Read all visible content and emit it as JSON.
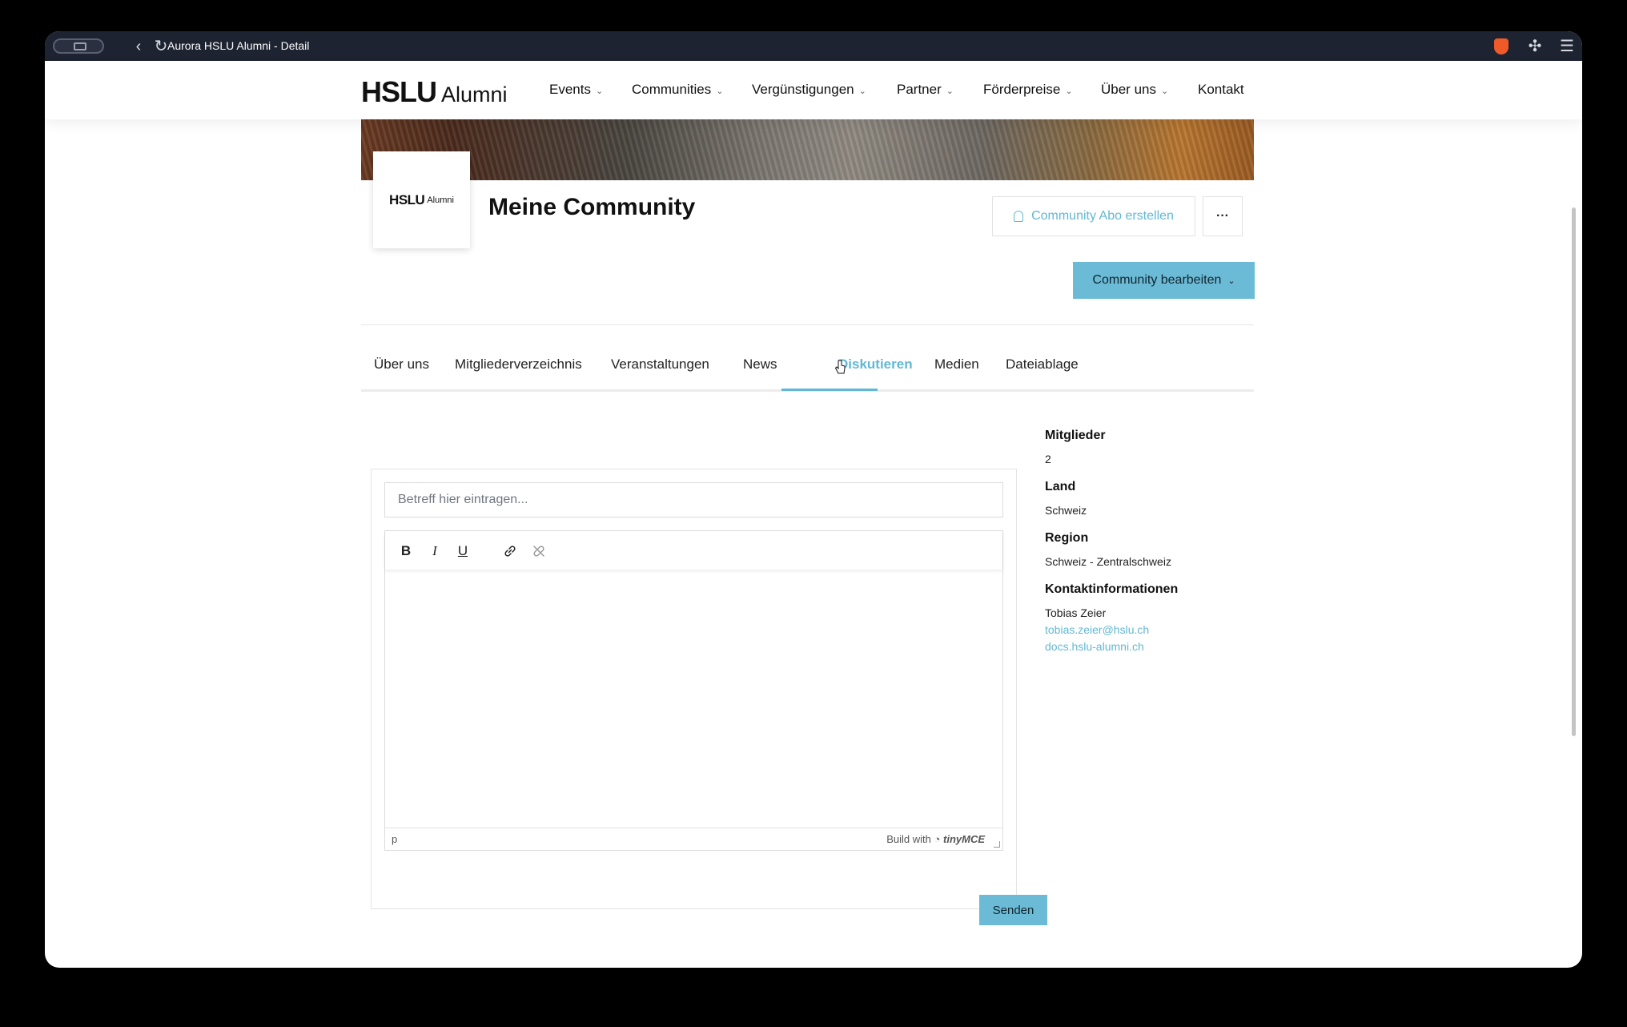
{
  "browser": {
    "tab_title": "Aurora HSLU Alumni - Detail"
  },
  "navbar": {
    "logo_main": "HSLU",
    "logo_sub": "Alumni",
    "items": [
      {
        "label": "Events"
      },
      {
        "label": "Communities"
      },
      {
        "label": "Vergünstigungen"
      },
      {
        "label": "Partner"
      },
      {
        "label": "Förderpreise"
      },
      {
        "label": "Über uns"
      },
      {
        "label": "Kontakt"
      }
    ]
  },
  "community": {
    "title": "Meine Community",
    "logo_main": "HSLU",
    "logo_sub": "Alumni",
    "abo_button": "Community Abo erstellen",
    "more_button": "···",
    "edit_button": "Community bearbeiten"
  },
  "tabs": [
    {
      "label": "Über uns"
    },
    {
      "label": "Mitgliederverzeichnis"
    },
    {
      "label": "Veranstaltungen"
    },
    {
      "label": "News"
    },
    {
      "label": "Diskutieren",
      "active": true
    },
    {
      "label": "Medien"
    },
    {
      "label": "Dateiablage"
    }
  ],
  "form": {
    "subject_placeholder": "Betreff hier eintragen...",
    "toolbar": {
      "bold": "B",
      "italic": "I",
      "underline": "U"
    },
    "status_path": "p",
    "status_brand_prefix": "Build with",
    "status_brand_name": "tinyMCE",
    "send_button": "Senden"
  },
  "sidebar": {
    "members_label": "Mitglieder",
    "members_value": "2",
    "country_label": "Land",
    "country_value": "Schweiz",
    "region_label": "Region",
    "region_value": "Schweiz - Zentralschweiz",
    "contact_label": "Kontaktinformationen",
    "contact_name": "Tobias Zeier",
    "contact_email": "tobias.zeier@hslu.ch",
    "contact_website": "docs.hslu-alumni.ch"
  },
  "colors": {
    "accent": "#62b8d3",
    "button_bg": "#6bbbd6",
    "titlebar_bg": "#1d2331"
  }
}
